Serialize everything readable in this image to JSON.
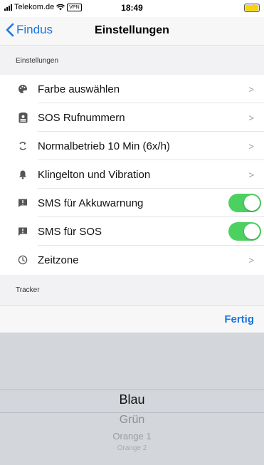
{
  "status_bar": {
    "carrier": "Telekom.de",
    "vpn": "VPN",
    "time": "18:49"
  },
  "nav": {
    "back_label": "Findus",
    "title": "Einstellungen"
  },
  "sections": {
    "settings_header": "Einstellungen",
    "tracker_header": "Tracker"
  },
  "settings_rows": [
    {
      "label": "Farbe auswählen",
      "icon": "palette-icon",
      "control": "chevron"
    },
    {
      "label": "SOS Rufnummern",
      "icon": "contact-card-icon",
      "control": "chevron"
    },
    {
      "label": "Normalbetrieb 10 Min (6x/h)",
      "icon": "refresh-icon",
      "control": "chevron"
    },
    {
      "label": "Klingelton und Vibration",
      "icon": "bell-icon",
      "control": "chevron"
    },
    {
      "label": "SMS für Akkuwarnung",
      "icon": "message-alert-icon",
      "control": "toggle",
      "on": true
    },
    {
      "label": "SMS für SOS",
      "icon": "message-alert-icon",
      "control": "toggle",
      "on": true
    },
    {
      "label": "Zeitzone",
      "icon": "clock-icon",
      "control": "chevron"
    }
  ],
  "toolbar": {
    "done_label": "Fertig"
  },
  "picker": {
    "options": [
      "Blau",
      "Grün",
      "Orange 1",
      "Orange 2"
    ],
    "selected": "Blau"
  },
  "colors": {
    "accent": "#1a76e3",
    "toggle_on": "#4cd160",
    "picker_bg": "#d3d6db"
  }
}
